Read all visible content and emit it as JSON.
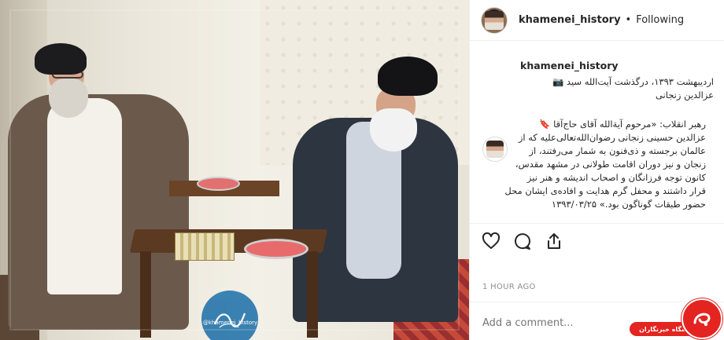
{
  "post": {
    "username": "khamenei_history",
    "follow_separator": "•",
    "follow_status": "Following"
  },
  "caption": {
    "username": "khamenei_history",
    "lines": [
      "اردیبهشت ۱۳۹۳، درگذشت آیت‌الله سید 📷",
      "عزالدین زنجانی"
    ]
  },
  "comment": {
    "lines": [
      "رهبر انقلاب: «مرحوم آیة‌الله آقای حاج‌آقا 🔖",
      "عزالدین حسینی زنجانی رضوان‌الله‌تعالی‌علیه که از",
      "عالمان برجسته و ذی‌فنون به شمار می‌رفتند، از",
      "زنجان و نیز دوران اقامت طولانی در مشهد مقدس،",
      "کانون توجه فرزانگان و اصحاب اندیشه و هنر نیز",
      "قرار داشتند و محفل گرم هدایت و افاده‌ی ایشان محل",
      "حضور طبقات گوناگون بود.» ۱۳۹۳/۰۳/۲۵"
    ]
  },
  "actions": {
    "like_icon": "heart-icon",
    "comment_icon": "comment-bubble-icon",
    "share_icon": "share-icon"
  },
  "timestamp": "1 HOUR AGO",
  "add_comment_placeholder": "Add a comment...",
  "watermark_text": "@khamenei_history",
  "brand_label": "باشگاه خبرنگاران",
  "colors": {
    "brand_red": "#e32420",
    "muted_text": "#8e8e8e",
    "border": "#efefef"
  }
}
